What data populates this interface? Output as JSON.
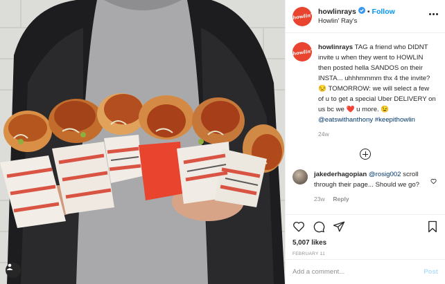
{
  "post": {
    "username": "howlinrays",
    "location": "Howlin' Ray's",
    "follow_label": "Follow",
    "avatar_text": "howlin'",
    "dot": "•"
  },
  "caption": {
    "username": "howlinrays",
    "text_1": "TAG a friend who DIDNT invite u when they went to HOWLIN then posted hella SANDOS on their INSTA... uhhhmmmm thx 4 the invite?",
    "emoji_1": "😒",
    "text_2": "TOMORROW: we will select a few of u to get a special Uber DELIVERY on us bc we",
    "emoji_heart": "❤️",
    "text_3": "u more.",
    "emoji_2": "😉",
    "mentions": "@eatswithanthony #keepithowlin",
    "age": "24w"
  },
  "comment": {
    "username": "jakederhagopian",
    "mention": "@rosig002",
    "text": "scroll through their page... Should we go?",
    "age": "23w",
    "reply_label": "Reply"
  },
  "actions": {
    "likes": "5,007 likes",
    "date": "FEBRUARY 11"
  },
  "add_comment": {
    "placeholder": "Add a comment...",
    "post_label": "Post"
  },
  "colors": {
    "accent": "#0095f6",
    "brand": "#e8442f",
    "post_disabled": "#b2dffc"
  },
  "icons": [
    "heart-icon",
    "comment-icon",
    "share-icon",
    "bookmark-icon",
    "verified-icon",
    "more-options-icon",
    "load-more-icon",
    "tagged-user-icon"
  ]
}
